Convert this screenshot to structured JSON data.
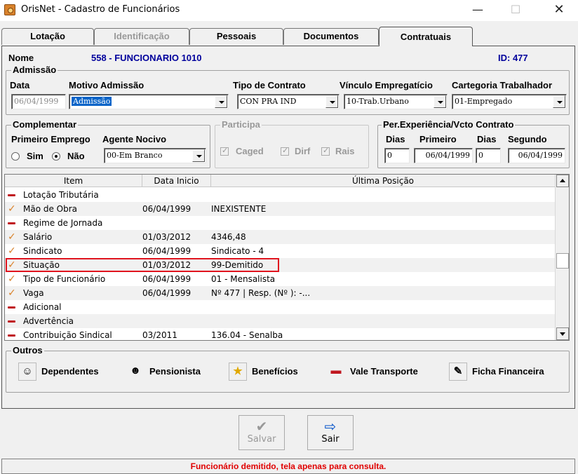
{
  "window": {
    "title": "OrisNet - Cadastro de Funcionários",
    "minimize": "—",
    "maximize": "☐",
    "close": "✕"
  },
  "tabs": [
    {
      "label": "Lotação",
      "state": "normal"
    },
    {
      "label": "Identificação",
      "state": "disabled"
    },
    {
      "label": "Pessoais",
      "state": "normal"
    },
    {
      "label": "Documentos",
      "state": "normal"
    },
    {
      "label": "Contratuais",
      "state": "active"
    }
  ],
  "header": {
    "nome_label": "Nome",
    "nome_value": "558 - FUNCIONARIO 1010",
    "id_text": "ID: 477"
  },
  "admissao": {
    "title": "Admissão",
    "data_label": "Data",
    "data_value": "06/04/1999",
    "motivo_label": "Motivo Admissão",
    "motivo_value": "Admissão",
    "tipo_label": "Tipo de Contrato",
    "tipo_value": "CON PRA IND",
    "vinculo_label": "Vínculo Empregatício",
    "vinculo_value": "10-Trab.Urbano",
    "categoria_label": "Cartegoria Trabalhador",
    "categoria_value": "01-Empregado"
  },
  "complementar": {
    "title": "Complementar",
    "primeiro_label": "Primeiro Emprego",
    "sim_label": "Sim",
    "nao_label": "Não",
    "agente_label": "Agente Nocivo",
    "agente_value": "00-Em Branco"
  },
  "participa": {
    "title": "Participa",
    "caged": "Caged",
    "dirf": "Dirf",
    "rais": "Rais"
  },
  "experiencia": {
    "title": "Per.Experiência/Vcto Contrato",
    "dias_label": "Dias",
    "primeiro_label": "Primeiro",
    "dias2_label": "Dias",
    "segundo_label": "Segundo",
    "dias_value": "0",
    "primeiro_value": "06/04/1999",
    "dias2_value": "0",
    "segundo_value": "06/04/1999"
  },
  "grid": {
    "columns": [
      "Item",
      "Data Inicio",
      "Última Posição"
    ],
    "rows": [
      {
        "status": "missing",
        "item": "Lotação Tributária",
        "data": "",
        "posicao": ""
      },
      {
        "status": "ok",
        "item": "Mão de Obra",
        "data": "06/04/1999",
        "posicao": "INEXISTENTE"
      },
      {
        "status": "missing",
        "item": "Regime de Jornada",
        "data": "",
        "posicao": ""
      },
      {
        "status": "ok",
        "item": "Salário",
        "data": "01/03/2012",
        "posicao": "4346,48"
      },
      {
        "status": "ok",
        "item": "Sindicato",
        "data": "06/04/1999",
        "posicao": "Sindicato - 4"
      },
      {
        "status": "ok",
        "item": "Situação",
        "data": "01/03/2012",
        "posicao": "99-Demitido"
      },
      {
        "status": "ok",
        "item": "Tipo de Funcionário",
        "data": "06/04/1999",
        "posicao": "01 - Mensalista"
      },
      {
        "status": "ok",
        "item": "Vaga",
        "data": "06/04/1999",
        "posicao": "Nº 477   | Resp. (Nº ): -..."
      },
      {
        "status": "missing",
        "item": "Adicional",
        "data": "",
        "posicao": ""
      },
      {
        "status": "missing",
        "item": "Advertência",
        "data": "",
        "posicao": ""
      },
      {
        "status": "missing",
        "item": "Contribuição Sindical",
        "data": "03/2011",
        "posicao": "136.04 - Senalba"
      }
    ]
  },
  "outros": {
    "title": "Outros",
    "dependentes": "Dependentes",
    "pensionista": "Pensionista",
    "beneficios": "Benefícios",
    "vale": "Vale Transporte",
    "ficha": "Ficha Financeira"
  },
  "footer": {
    "salvar": "Salvar",
    "sair": "Sair"
  },
  "status_message": "Funcionário demitido, tela apenas para consulta."
}
